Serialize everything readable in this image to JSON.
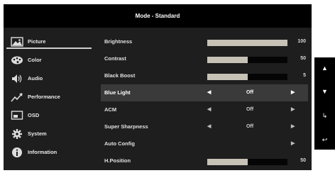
{
  "title": "Mode - Standard",
  "categories": [
    {
      "label": "Picture",
      "icon": "picture-icon"
    },
    {
      "label": "Color",
      "icon": "color-palette-icon"
    },
    {
      "label": "Audio",
      "icon": "speaker-icon"
    },
    {
      "label": "Performance",
      "icon": "performance-graph-icon"
    },
    {
      "label": "OSD",
      "icon": "osd-monitor-icon"
    },
    {
      "label": "System",
      "icon": "gear-icon"
    },
    {
      "label": "Information",
      "icon": "info-icon"
    }
  ],
  "settings": [
    {
      "label": "Brightness",
      "value": "100",
      "level": 1.0
    },
    {
      "label": "Contrast",
      "value": "50",
      "level": 0.5
    },
    {
      "label": "Black Boost",
      "value": "5",
      "level": 0.5
    },
    {
      "label": "Blue Light",
      "option": "Off"
    },
    {
      "label": "ACM",
      "option": "Off"
    },
    {
      "label": "Super Sharpness",
      "option": "Off"
    },
    {
      "label": "Auto Config"
    },
    {
      "label": "H.Position",
      "value": "50",
      "level": 0.5
    }
  ],
  "nav_keys": [
    {
      "icon": "arrow-up-icon",
      "glyph": "▲"
    },
    {
      "icon": "arrow-down-icon",
      "glyph": "▼"
    },
    {
      "icon": "enter-icon",
      "glyph": "↳"
    },
    {
      "icon": "back-icon",
      "glyph": "↩"
    }
  ],
  "colors": {
    "panel": "#1e1e1e",
    "titlebar": "#000000",
    "bar_fill": "#c7c2b6",
    "selected_row": "#3a3a3a"
  }
}
